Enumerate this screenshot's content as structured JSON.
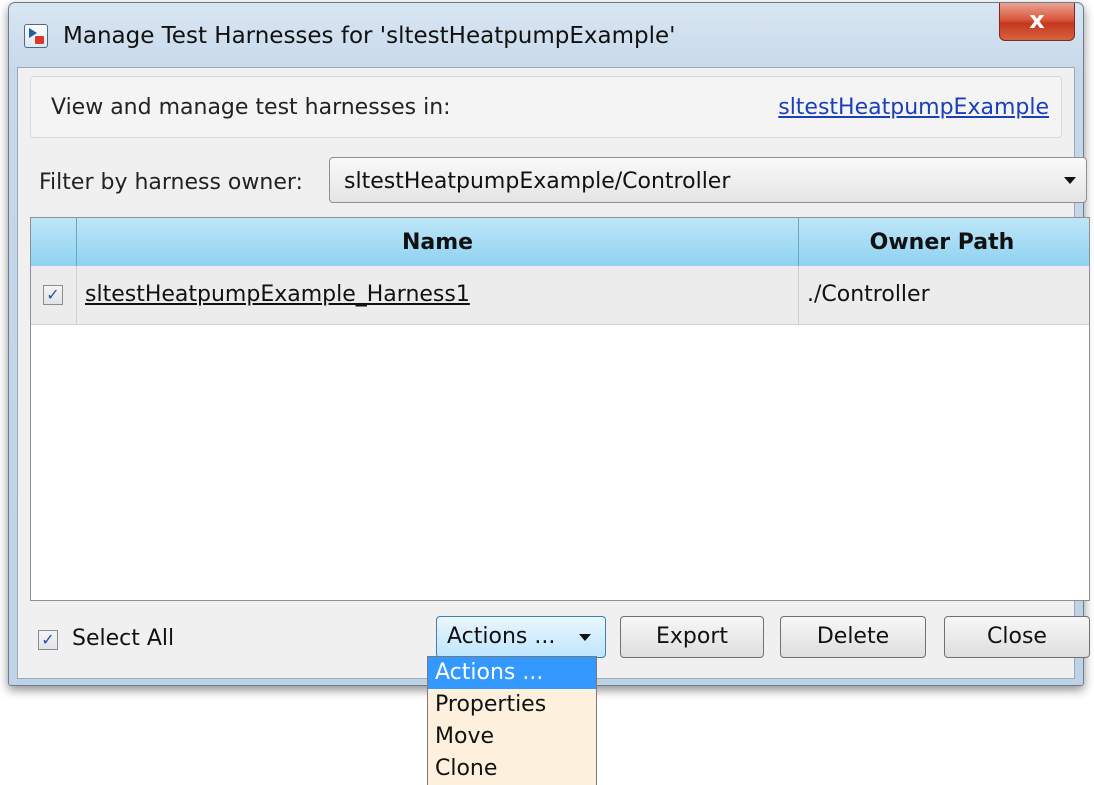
{
  "window": {
    "title": "Manage Test Harnesses for 'sltestHeatpumpExample'",
    "close_glyph": "x"
  },
  "info": {
    "label": "View and manage test harnesses in:",
    "model_link": "sltestHeatpumpExample"
  },
  "filter": {
    "label": "Filter by harness owner:",
    "value": "sltestHeatpumpExample/Controller"
  },
  "table": {
    "columns": [
      "Name",
      "Owner Path"
    ],
    "rows": [
      {
        "checked": true,
        "name": "sltestHeatpumpExample_Harness1",
        "owner_path": "./Controller"
      }
    ]
  },
  "footer": {
    "select_all_label": "Select All",
    "select_all_checked": true,
    "actions_label": "Actions ...",
    "export_label": "Export",
    "delete_label": "Delete",
    "close_label": "Close"
  },
  "actions_menu": {
    "items": [
      "Actions ...",
      "Properties",
      "Move",
      "Clone"
    ],
    "selected_index": 0
  },
  "colors": {
    "header_gradient_top": "#bfe6f8",
    "header_gradient_bottom": "#8fd2f1",
    "link": "#1a3fb8",
    "menu_bg": "#fdf0dc",
    "menu_selected": "#3399ff"
  },
  "icons": [
    "simulink-app-icon",
    "close-icon",
    "chevron-down-icon",
    "checkbox-checked-icon"
  ]
}
